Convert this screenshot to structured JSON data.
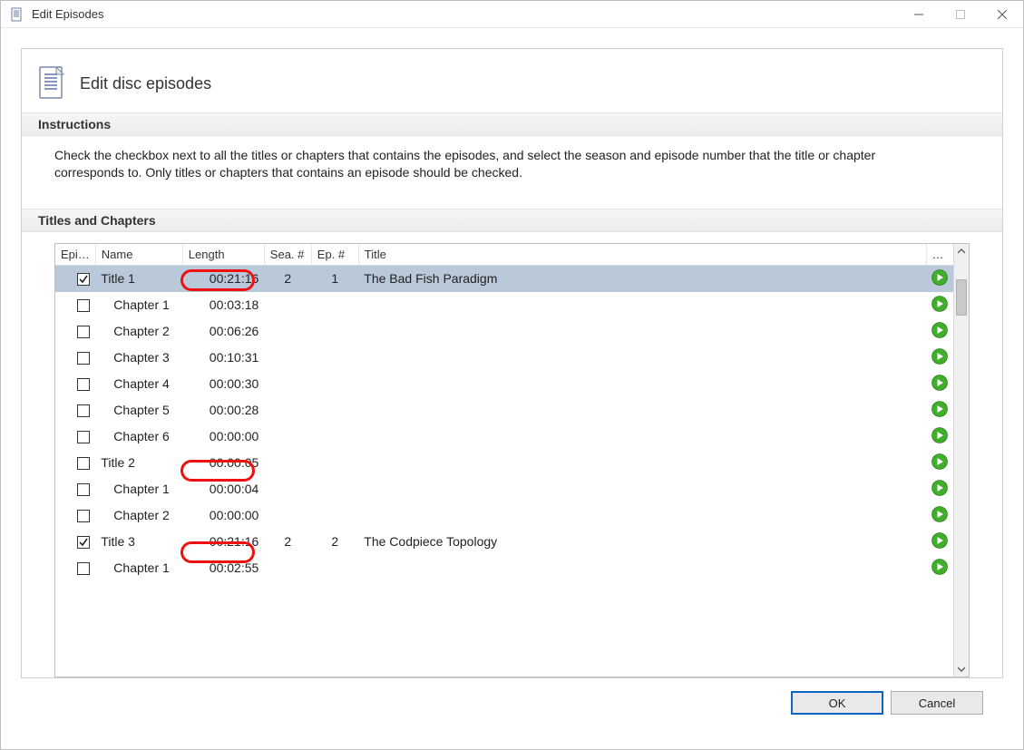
{
  "window": {
    "title": "Edit Episodes"
  },
  "header": {
    "title": "Edit disc episodes"
  },
  "instructions": {
    "label": "Instructions",
    "text": "Check the checkbox next to all the titles or chapters that contains the episodes, and select the season and episode number that the title or chapter corresponds to. Only titles or chapters that contains an episode should be checked."
  },
  "titles_section": {
    "label": "Titles and Chapters"
  },
  "columns": {
    "episode": "Epi…",
    "name": "Name",
    "length": "Length",
    "season": "Sea. #",
    "ep": "Ep. #",
    "title": "Title",
    "more": "…"
  },
  "rows": [
    {
      "checked": true,
      "indent": 0,
      "name": "Title 1",
      "length": "00:21:16",
      "season": "2",
      "ep": "1",
      "title": "The Bad Fish Paradigm",
      "selected": true
    },
    {
      "checked": false,
      "indent": 1,
      "name": "Chapter 1",
      "length": "00:03:18",
      "season": "",
      "ep": "",
      "title": ""
    },
    {
      "checked": false,
      "indent": 1,
      "name": "Chapter 2",
      "length": "00:06:26",
      "season": "",
      "ep": "",
      "title": ""
    },
    {
      "checked": false,
      "indent": 1,
      "name": "Chapter 3",
      "length": "00:10:31",
      "season": "",
      "ep": "",
      "title": ""
    },
    {
      "checked": false,
      "indent": 1,
      "name": "Chapter 4",
      "length": "00:00:30",
      "season": "",
      "ep": "",
      "title": ""
    },
    {
      "checked": false,
      "indent": 1,
      "name": "Chapter 5",
      "length": "00:00:28",
      "season": "",
      "ep": "",
      "title": ""
    },
    {
      "checked": false,
      "indent": 1,
      "name": "Chapter 6",
      "length": "00:00:00",
      "season": "",
      "ep": "",
      "title": ""
    },
    {
      "checked": false,
      "indent": 0,
      "name": "Title 2",
      "length": "00:00:05",
      "season": "",
      "ep": "",
      "title": ""
    },
    {
      "checked": false,
      "indent": 1,
      "name": "Chapter 1",
      "length": "00:00:04",
      "season": "",
      "ep": "",
      "title": ""
    },
    {
      "checked": false,
      "indent": 1,
      "name": "Chapter 2",
      "length": "00:00:00",
      "season": "",
      "ep": "",
      "title": ""
    },
    {
      "checked": true,
      "indent": 0,
      "name": "Title 3",
      "length": "00:21:16",
      "season": "2",
      "ep": "2",
      "title": "The Codpiece Topology"
    },
    {
      "checked": false,
      "indent": 1,
      "name": "Chapter 1",
      "length": "00:02:55",
      "season": "",
      "ep": "",
      "title": ""
    }
  ],
  "buttons": {
    "ok": "OK",
    "cancel": "Cancel"
  }
}
